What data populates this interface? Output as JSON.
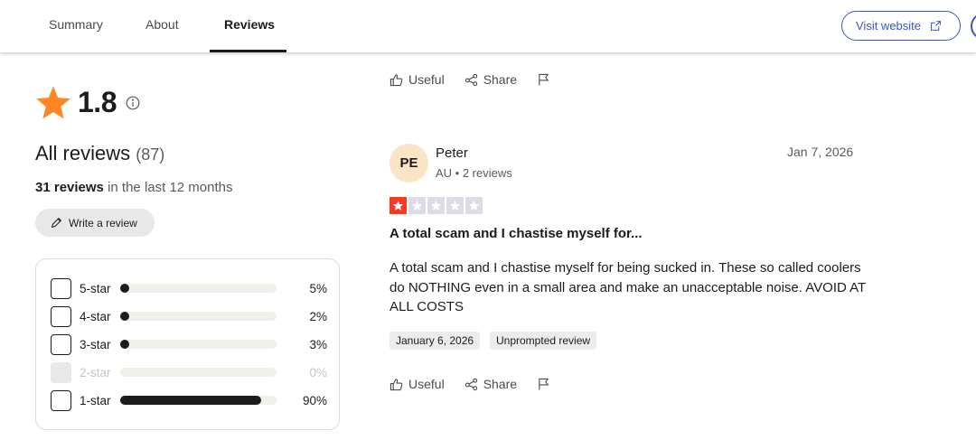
{
  "nav": {
    "tabs": [
      {
        "label": "Summary"
      },
      {
        "label": "About"
      },
      {
        "label": "Reviews"
      }
    ],
    "visit_label": "Visit website"
  },
  "rating": {
    "value": "1.8"
  },
  "reviews_summary": {
    "title": "All reviews",
    "count": "(87)",
    "recent_count": "31 reviews",
    "recent_suffix": "in the last 12 months",
    "write_label": "Write a review"
  },
  "distribution": [
    {
      "label": "5-star",
      "percent": "5%",
      "fraction": 0.05,
      "enabled": true
    },
    {
      "label": "4-star",
      "percent": "2%",
      "fraction": 0.02,
      "enabled": true
    },
    {
      "label": "3-star",
      "percent": "3%",
      "fraction": 0.03,
      "enabled": true
    },
    {
      "label": "2-star",
      "percent": "0%",
      "fraction": 0.0,
      "enabled": false
    },
    {
      "label": "1-star",
      "percent": "90%",
      "fraction": 0.9,
      "enabled": true
    }
  ],
  "actions": {
    "useful_label": "Useful",
    "share_label": "Share"
  },
  "review": {
    "initials": "PE",
    "name": "Peter",
    "meta": "AU • 2 reviews",
    "date": "Jan 7, 2026",
    "stars": 1,
    "title": "A total scam and I chastise myself for...",
    "body": "A total scam and I chastise myself for being sucked in. These so called coolers do NOTHING even in a small area and make an unacceptable noise. AVOID AT ALL COSTS",
    "tags": [
      "January 6, 2026",
      "Unprompted review"
    ]
  },
  "colors": {
    "accent": "#3c57bc",
    "star_orange": "#ff8622",
    "star_red": "#ff3722"
  }
}
